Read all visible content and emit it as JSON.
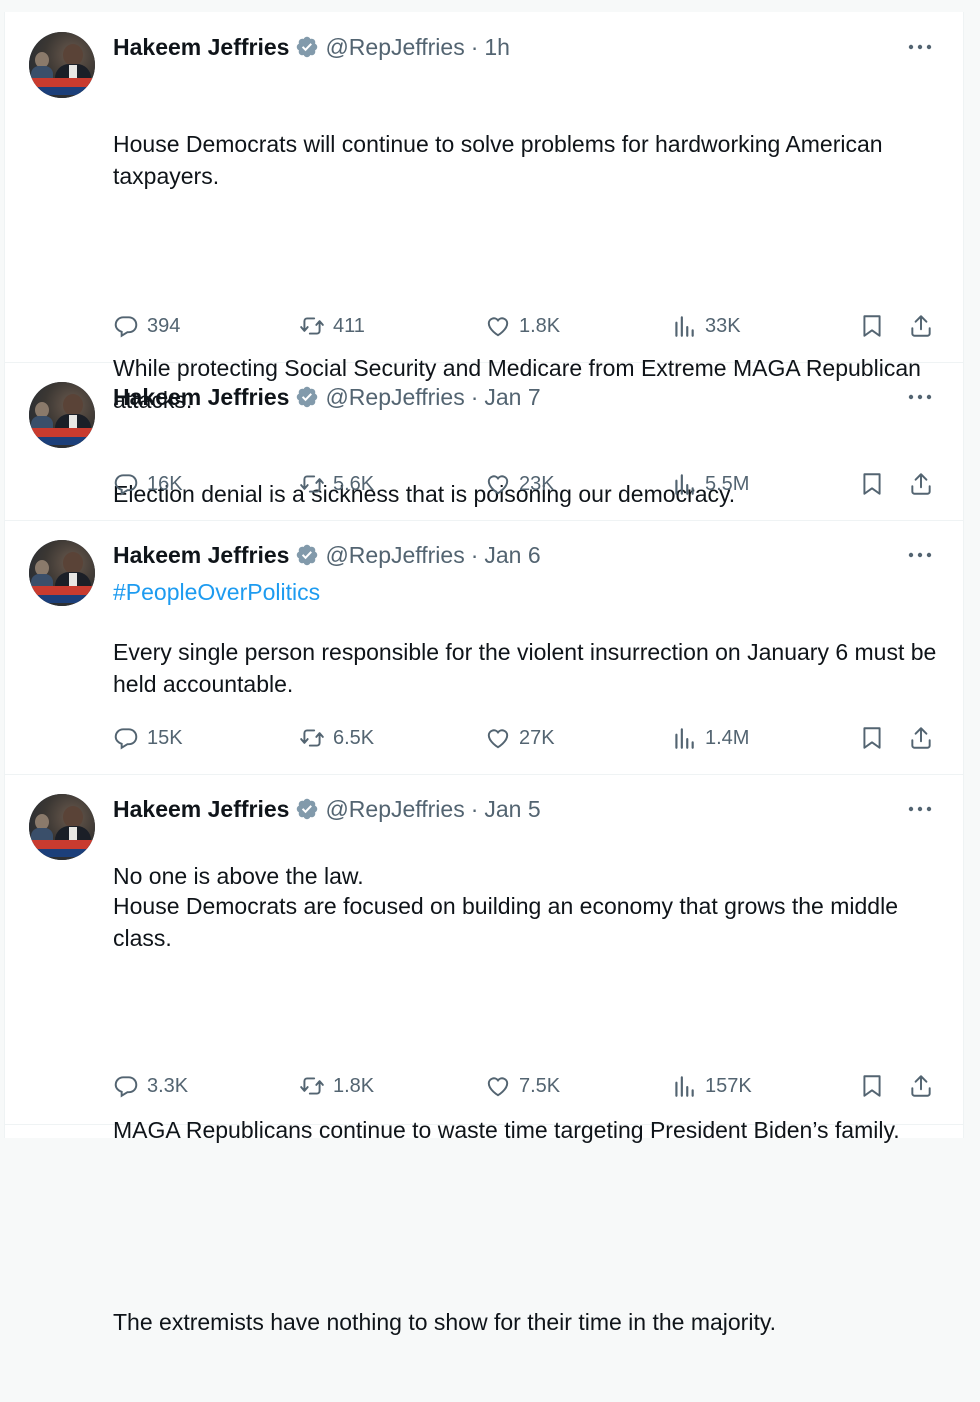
{
  "tweets": [
    {
      "name": "Hakeem Jeffries",
      "handle": "@RepJeffries",
      "time": "1h",
      "paragraphs": [
        "House Democrats will continue to solve problems for hardworking American taxpayers.",
        "While protecting Social Security and Medicare from Extreme MAGA Republican attacks."
      ],
      "hashtag": "#PeopleOverPolitics",
      "replies": "394",
      "retweets": "411",
      "likes": "1.8K",
      "views": "33K"
    },
    {
      "name": "Hakeem Jeffries",
      "handle": "@RepJeffries",
      "time": "Jan 7",
      "paragraphs": [
        "Election denial is a sickness that is poisoning our democracy."
      ],
      "replies": "16K",
      "retweets": "5.6K",
      "likes": "23K",
      "views": "5.5M"
    },
    {
      "name": "Hakeem Jeffries",
      "handle": "@RepJeffries",
      "time": "Jan 6",
      "paragraphs": [
        "Every single person responsible for the violent insurrection on January 6 must be held accountable.",
        "No one is above the law."
      ],
      "replies": "15K",
      "retweets": "6.5K",
      "likes": "27K",
      "views": "1.4M"
    },
    {
      "name": "Hakeem Jeffries",
      "handle": "@RepJeffries",
      "time": "Jan 5",
      "paragraphs": [
        "House Democrats are focused on building an economy that grows the middle class.",
        "MAGA Republicans continue to waste time targeting President Biden’s family.",
        "The extremists have nothing to show for their time in the majority."
      ],
      "replies": "3.3K",
      "retweets": "1.8K",
      "likes": "7.5K",
      "views": "157K"
    }
  ],
  "icons": {
    "verified": "verified-badge-icon",
    "more": "more-icon",
    "reply": "reply-icon",
    "retweet": "retweet-icon",
    "like": "like-icon",
    "views": "views-icon",
    "bookmark": "bookmark-icon",
    "share": "share-icon"
  },
  "colors": {
    "text": "#0f1419",
    "secondary": "#536471",
    "hashtag": "#1d9bf0",
    "verified": "#829aab"
  }
}
